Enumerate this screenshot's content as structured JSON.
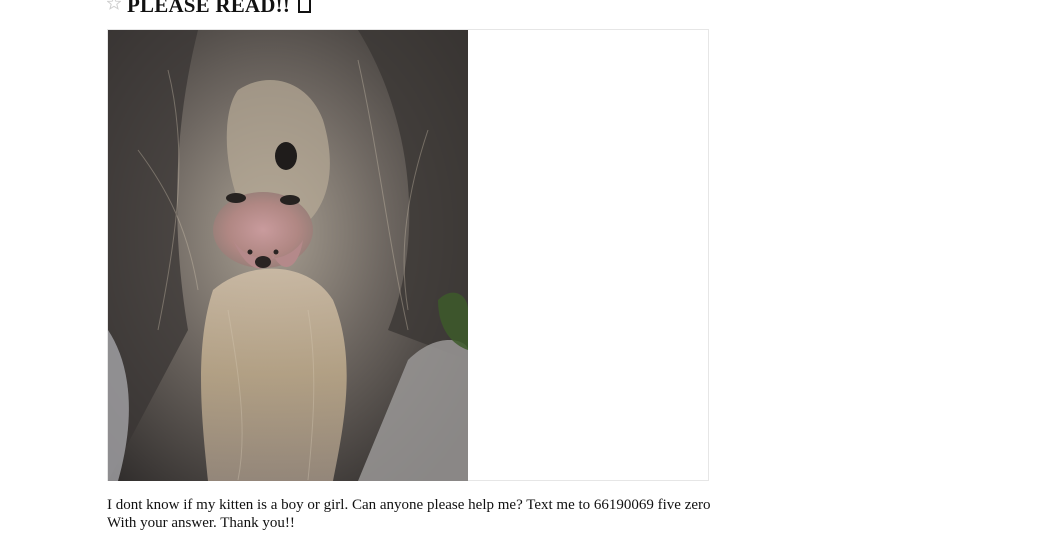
{
  "post": {
    "title": "PLEASE READ!!",
    "body_lines": [
      "I dont know if my kitten is a boy or girl. Can anyone please help me? Text me to 66190069 five zero",
      "With your answer. Thank you!!"
    ]
  },
  "icons": {
    "favorite": "star-icon",
    "title_glyph": "missing-glyph-box"
  },
  "colors": {
    "text": "#111111",
    "gallery_border": "#e6e6e6",
    "star": "#cfcfcf"
  }
}
